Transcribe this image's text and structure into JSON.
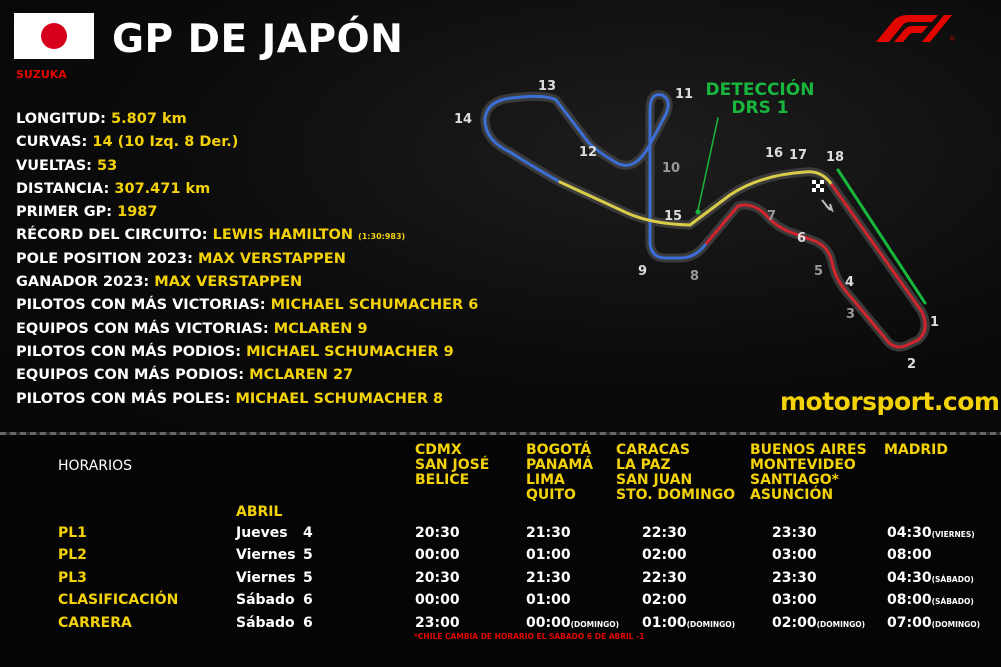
{
  "header": {
    "title": "GP DE JAPÓN",
    "circuit": "SUZUKA",
    "colors": {
      "accent_yellow": "#f4d20a",
      "accent_red": "#e10600",
      "drs_green": "#19b63d"
    }
  },
  "stats": [
    {
      "label": "LONGITUD:",
      "value": "5.807 km"
    },
    {
      "label": "CURVAS:",
      "value": "14 (10 Izq. 8 Der.)"
    },
    {
      "label": "VUELTAS:",
      "value": "53"
    },
    {
      "label": "DISTANCIA:",
      "value": "307.471 km"
    },
    {
      "label": "PRIMER GP:",
      "value": "1987"
    },
    {
      "label": "RÉCORD DEL CIRCUITO:",
      "value": "LEWIS HAMILTON",
      "note": "(1:30:983)"
    },
    {
      "label": "POLE POSITION 2023:",
      "value": "MAX VERSTAPPEN"
    },
    {
      "label": "GANADOR 2023:",
      "value": "MAX VERSTAPPEN"
    },
    {
      "label": "PILOTOS CON MÁS VICTORIAS:",
      "value": "MICHAEL SCHUMACHER 6"
    },
    {
      "label": "EQUIPOS CON MÁS VICTORIAS:",
      "value": "MCLAREN 9"
    },
    {
      "label": "PILOTOS CON MÁS PODIOS:",
      "value": "MICHAEL SCHUMACHER 9"
    },
    {
      "label": "EQUIPOS CON MÁS PODIOS:",
      "value": "MCLAREN 27"
    },
    {
      "label": "PILOTOS CON MÁS POLES:",
      "value": "MICHAEL SCHUMACHER 8"
    }
  ],
  "track": {
    "drs_label_1": "DETECCIÓN",
    "drs_label_2": "DRS 1",
    "turns": [
      "1",
      "2",
      "3",
      "4",
      "5",
      "6",
      "7",
      "8",
      "9",
      "10",
      "11",
      "12",
      "13",
      "14",
      "15",
      "16",
      "17",
      "18"
    ]
  },
  "brand": "motorsport.com",
  "schedule": {
    "title": "HORARIOS",
    "month": "ABRIL",
    "zones": [
      [
        "CDMX",
        "SAN JOSÉ",
        "BELICE"
      ],
      [
        "BOGOTÁ",
        "PANAMÁ",
        "LIMA",
        "QUITO"
      ],
      [
        "CARACAS",
        "LA PAZ",
        "SAN JUAN",
        "STO. DOMINGO"
      ],
      [
        "BUENOS AIRES",
        "MONTEVIDEO",
        "SANTIAGO*",
        "ASUNCIÓN"
      ],
      [
        "MADRID"
      ]
    ],
    "sessions": [
      {
        "name": "PL1",
        "day": "Jueves",
        "date": "4",
        "times": [
          {
            "t": "20:30"
          },
          {
            "t": "21:30"
          },
          {
            "t": "22:30"
          },
          {
            "t": "23:30"
          },
          {
            "t": "04:30",
            "n": "(VIERNES)"
          }
        ]
      },
      {
        "name": "PL2",
        "day": "Viernes",
        "date": "5",
        "times": [
          {
            "t": "00:00"
          },
          {
            "t": "01:00"
          },
          {
            "t": "02:00"
          },
          {
            "t": "03:00"
          },
          {
            "t": "08:00"
          }
        ]
      },
      {
        "name": "PL3",
        "day": "Viernes",
        "date": "5",
        "times": [
          {
            "t": "20:30"
          },
          {
            "t": "21:30"
          },
          {
            "t": "22:30"
          },
          {
            "t": "23:30"
          },
          {
            "t": "04:30",
            "n": "(SÁBADO)"
          }
        ]
      },
      {
        "name": "CLASIFICACIÓN",
        "day": "Sábado",
        "date": "6",
        "times": [
          {
            "t": "00:00"
          },
          {
            "t": "01:00"
          },
          {
            "t": "02:00"
          },
          {
            "t": "03:00"
          },
          {
            "t": "08:00",
            "n": "(SÁBADO)"
          }
        ]
      },
      {
        "name": "CARRERA",
        "day": "Sábado",
        "date": "6",
        "times": [
          {
            "t": "23:00"
          },
          {
            "t": "00:00",
            "n": "(DOMINGO)"
          },
          {
            "t": "01:00",
            "n": "(DOMINGO)"
          },
          {
            "t": "02:00",
            "n": "(DOMINGO)"
          },
          {
            "t": "07:00",
            "n": "(DOMINGO)"
          }
        ]
      }
    ],
    "footnote": "*CHILE CAMBIA DE HORARIO EL SÁBADO 6 DE ABRIL -1"
  }
}
